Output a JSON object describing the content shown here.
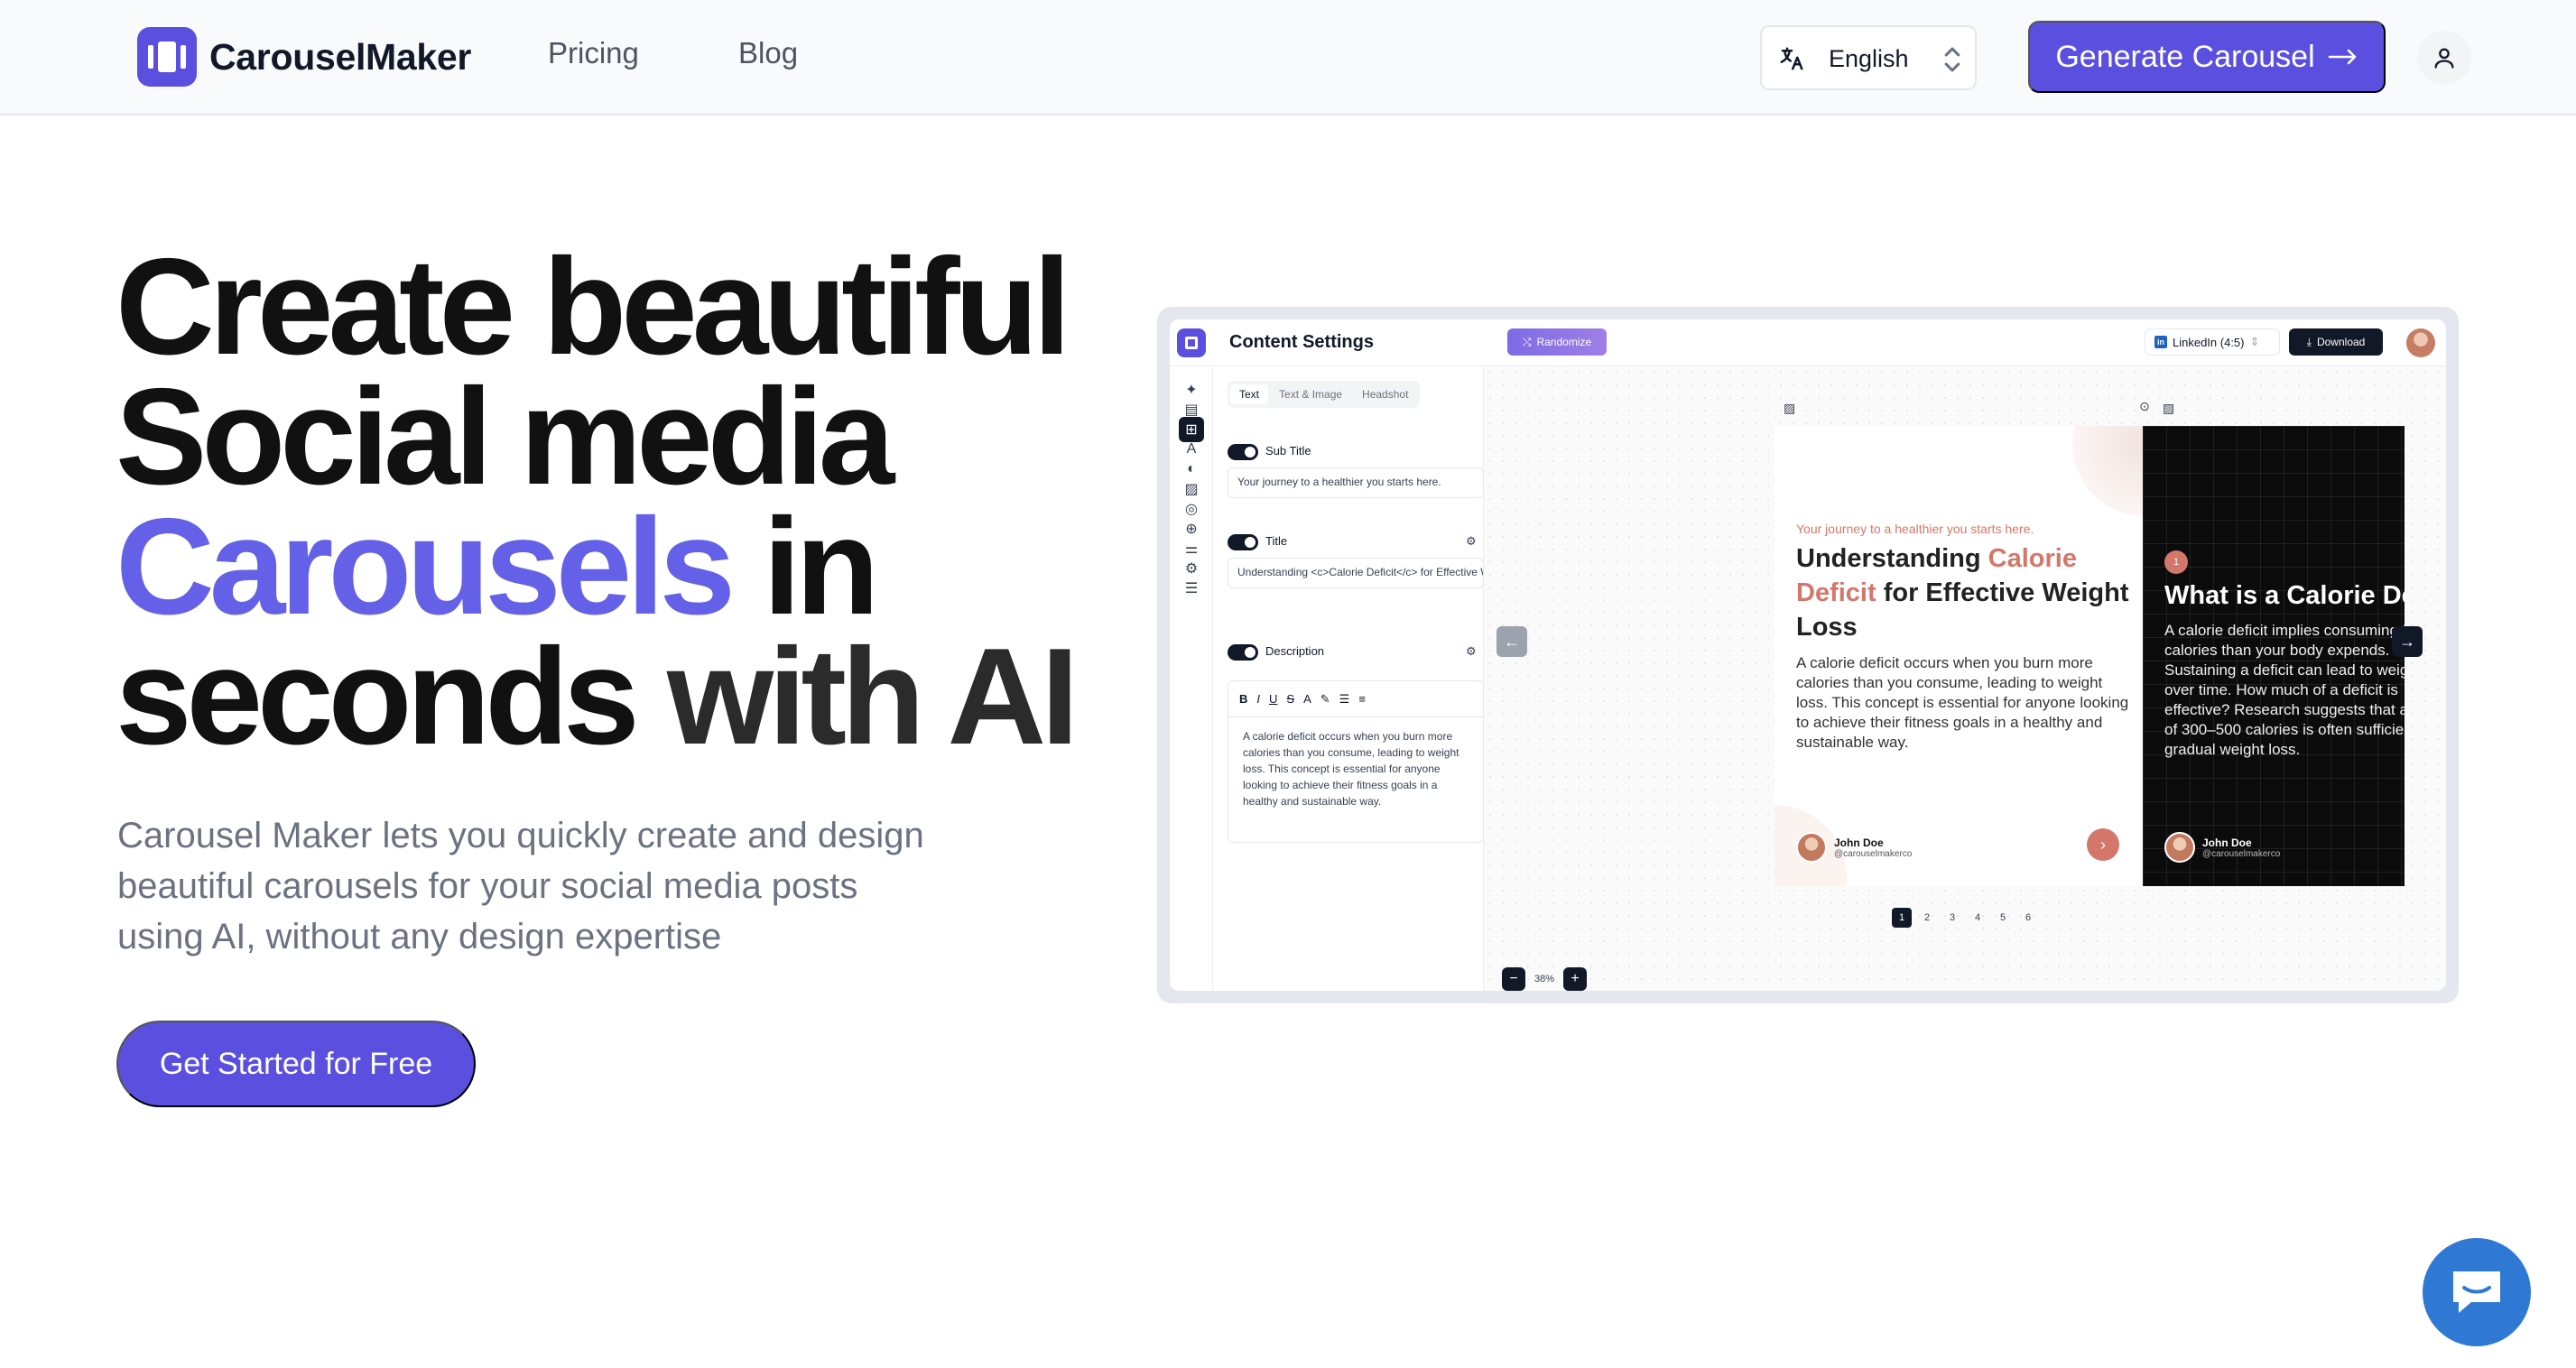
{
  "header": {
    "brand": "CarouselMaker",
    "nav": {
      "pricing": "Pricing",
      "blog": "Blog"
    },
    "language": "English",
    "cta": "Generate Carousel"
  },
  "hero": {
    "title_line1": "Create beautiful",
    "title_line2": "Social media",
    "title_accent": "Carousels",
    "title_line3_rest": " in",
    "title_line4a": "seconds ",
    "title_line4b": "with AI",
    "subtitle": "Carousel Maker lets you quickly create and design beautiful carousels for your social media posts using AI, without any design expertise",
    "cta": "Get Started for Free"
  },
  "mockup": {
    "title": "Content Settings",
    "randomize": "Randomize",
    "format": "LinkedIn (4:5)",
    "download": "Download",
    "tabs": [
      "Text",
      "Text & Image",
      "Headshot"
    ],
    "fields": {
      "subtitle_label": "Sub Title",
      "subtitle_value": "Your journey to a healthier you starts here.",
      "title_label": "Title",
      "title_value": "Understanding <c>Calorie Deficit</c> for Effective Weight Loss",
      "description_label": "Description",
      "description_value": "A calorie deficit occurs when you burn more calories than you consume, leading to weight loss. This concept is essential for anyone looking to achieve their fitness goals in a healthy and sustainable way."
    },
    "slide1": {
      "subtitle": "Your journey to a healthier you starts here.",
      "title_a": "Understanding ",
      "title_hl": "Calorie Deficit",
      "title_b": " for Effective Weight Loss",
      "description": "A calorie deficit occurs when you burn more calories than you consume, leading to weight loss. This concept is essential for anyone looking to achieve their fitness goals in a healthy and sustainable way.",
      "author": "John Doe",
      "handle": "@carouselmakerco"
    },
    "slide2": {
      "number": "1",
      "title": "What is a Calorie Deficit?",
      "description": "A calorie deficit implies consuming fewer calories than your body expends. Sustaining a deficit can lead to weight loss over time. How much of a deficit is effective? Research suggests that a deficit of 300–500 calories is often sufficient for gradual weight loss.",
      "author": "John Doe",
      "handle": "@carouselmakerco"
    },
    "pages": [
      "1",
      "2",
      "3",
      "4",
      "5",
      "6"
    ],
    "zoom": "38%"
  },
  "colors": {
    "brand": "#5b4fe0",
    "accent_text": "#6461e8",
    "slide_accent": "#d4776a",
    "chat": "#2f79d4"
  }
}
